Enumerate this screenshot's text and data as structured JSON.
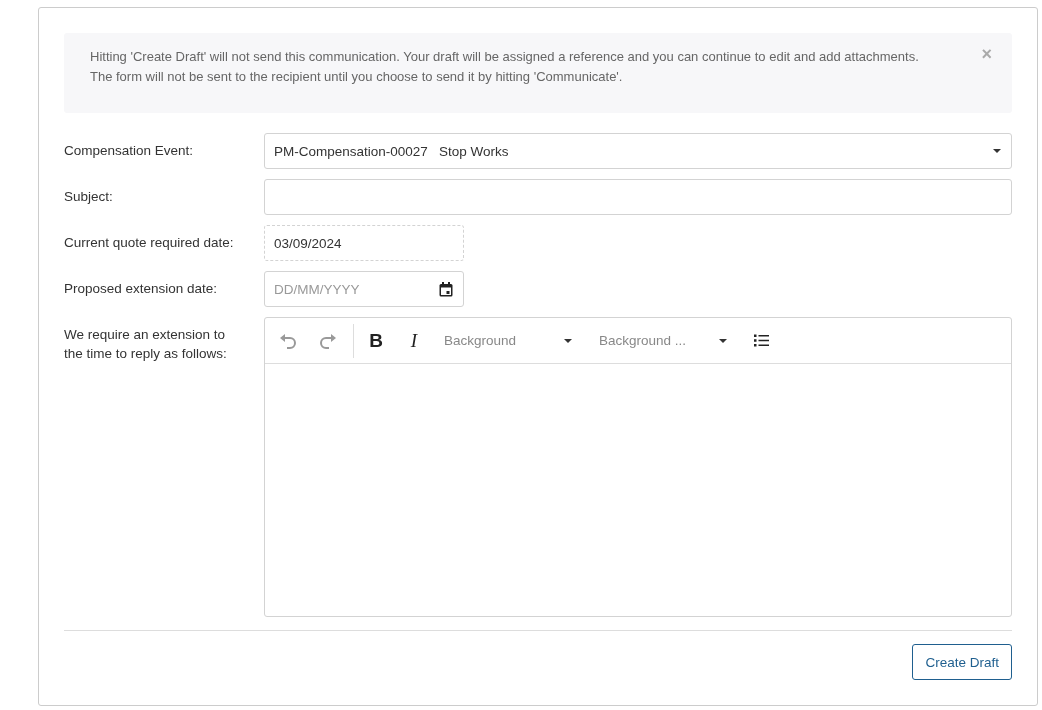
{
  "alert": {
    "text": "Hitting 'Create Draft' will not send this communication. Your draft will be assigned a reference and you can continue to edit and add attachments. The form will not be sent to the recipient until you choose to send it by hitting 'Communicate'.",
    "close": "×"
  },
  "fields": [
    {
      "kind": "select",
      "label": "Compensation Event:",
      "value": "PM-Compensation-00027   Stop Works"
    },
    {
      "kind": "text",
      "label": "Subject:"
    },
    {
      "kind": "readonly",
      "label": "Current quote required date:",
      "value": "03/09/2024"
    },
    {
      "kind": "date",
      "label": "Proposed extension date:",
      "placeholder": "DD/MM/YYYY"
    },
    {
      "kind": "editor",
      "label": "We require an extension to the time to reply as follows:"
    }
  ],
  "toolbar": [
    {
      "kind": "undo"
    },
    {
      "kind": "redo"
    },
    {
      "kind": "separator"
    },
    {
      "kind": "bold",
      "label": "B"
    },
    {
      "kind": "italic",
      "label": "I"
    },
    {
      "kind": "dropdown",
      "label": "Background"
    },
    {
      "kind": "dropdown",
      "label": "Background ..."
    },
    {
      "kind": "list"
    }
  ],
  "submit": "Create Draft"
}
